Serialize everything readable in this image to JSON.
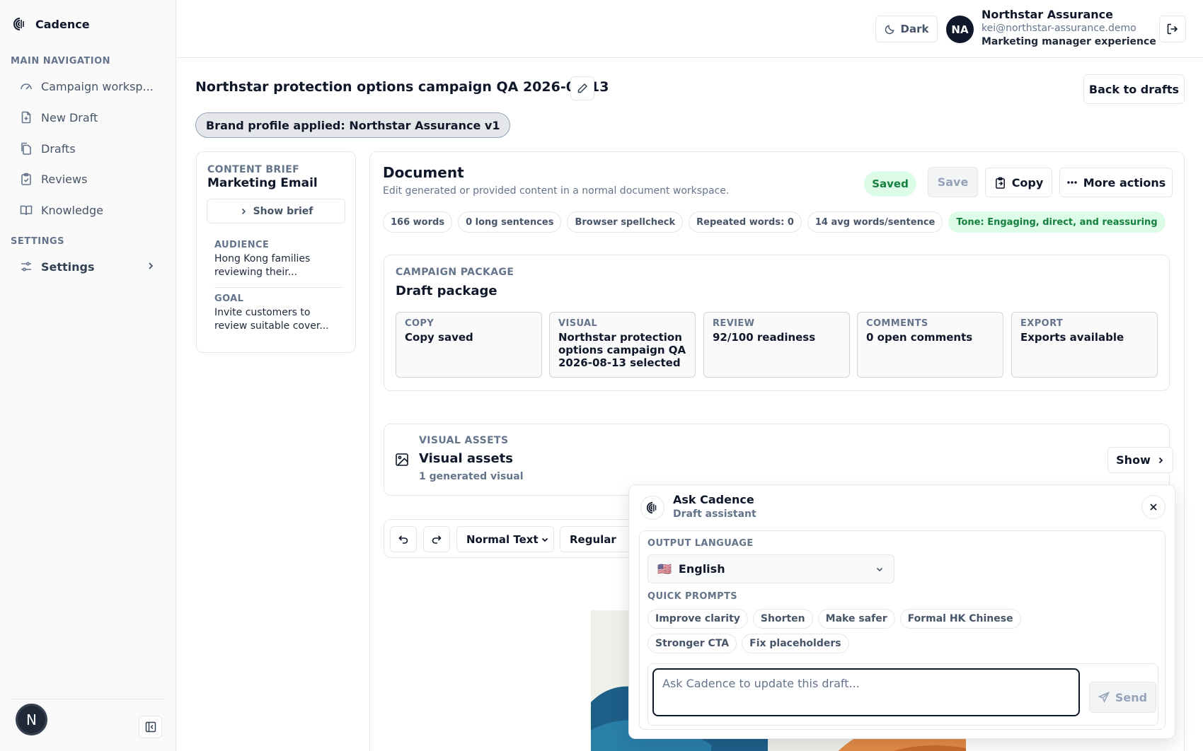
{
  "app": {
    "name": "Cadence"
  },
  "sidebar": {
    "main_label": "MAIN NAVIGATION",
    "items": [
      {
        "label": "Campaign worksp...",
        "icon": "gauge-icon"
      },
      {
        "label": "New Draft",
        "icon": "file-plus-icon"
      },
      {
        "label": "Drafts",
        "icon": "files-icon"
      },
      {
        "label": "Reviews",
        "icon": "clipboard-check-icon"
      },
      {
        "label": "Knowledge",
        "icon": "book-open-icon"
      }
    ],
    "settings_label": "SETTINGS",
    "settings_item": "Settings",
    "bottom_avatar": "N"
  },
  "header": {
    "theme_toggle": "Dark",
    "user_initials": "NA",
    "user_name": "Northstar Assurance",
    "user_email": "kei@northstar-assurance.demo",
    "user_role": "Marketing manager experience"
  },
  "page": {
    "title": "Northstar protection options campaign QA 2026-08-13",
    "back_button": "Back to drafts",
    "brand_pill": "Brand profile applied: Northstar Assurance v1"
  },
  "brief": {
    "label": "CONTENT BRIEF",
    "type": "Marketing Email",
    "show_button": "Show brief",
    "audience_label": "AUDIENCE",
    "audience_value": "Hong Kong families reviewing their...",
    "goal_label": "GOAL",
    "goal_value": "Invite customers to review suitable cover..."
  },
  "document": {
    "title": "Document",
    "subtitle": "Edit generated or provided content in a normal document workspace.",
    "status": "Saved",
    "save_button": "Save",
    "copy_button": "Copy",
    "more_button": "More actions",
    "stats": [
      "166 words",
      "0 long sentences",
      "Browser spellcheck",
      "Repeated words: 0",
      "14 avg words/sentence"
    ],
    "tone": "Tone: Engaging, direct, and reassuring"
  },
  "package": {
    "label": "CAMPAIGN PACKAGE",
    "title": "Draft package",
    "tiles": [
      {
        "label": "COPY",
        "value": "Copy saved"
      },
      {
        "label": "VISUAL",
        "value": "Northstar protection options campaign QA 2026-08-13 selected"
      },
      {
        "label": "REVIEW",
        "value": "92/100 readiness"
      },
      {
        "label": "COMMENTS",
        "value": "0 open comments"
      },
      {
        "label": "EXPORT",
        "value": "Exports available"
      }
    ]
  },
  "visual_assets": {
    "label": "VISUAL ASSETS",
    "title": "Visual assets",
    "count": "1 generated visual",
    "show_button": "Show"
  },
  "toolbar": {
    "style_select": "Normal Text",
    "weight_select": "Regular"
  },
  "assistant": {
    "title": "Ask Cadence",
    "subtitle": "Draft assistant",
    "language_label": "OUTPUT LANGUAGE",
    "language_flag": "🇺🇸",
    "language_value": "English",
    "prompts_label": "QUICK PROMPTS",
    "prompts": [
      "Improve clarity",
      "Shorten",
      "Make safer",
      "Formal HK Chinese",
      "Stronger CTA",
      "Fix placeholders"
    ],
    "input_placeholder": "Ask Cadence to update this draft...",
    "send_button": "Send"
  },
  "colors": {
    "accent_dark": "#0f172a",
    "success_bg": "#dcfce7",
    "success_text": "#15803d",
    "border": "#e5e7eb",
    "muted": "#64748b"
  }
}
